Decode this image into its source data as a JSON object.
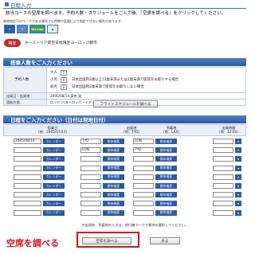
{
  "page": {
    "title": "日程入力",
    "intro": "該当コースの空席を調べます。予約人数・スケジュールをご入力後、『空席を調べる』をクリックしてください。",
    "note": "座席指定可のマークがある場合でも時期や区間により指定できない場合があります"
  },
  "icons": [
    {
      "name": "seat-icon",
      "label": "✈"
    },
    {
      "name": "info-icon",
      "label": "i"
    },
    {
      "name": "online-icon",
      "label": "On Line"
    },
    {
      "name": "ticket-icon",
      "label": "◆"
    }
  ],
  "plan": {
    "badge": "格安",
    "name": "オーストリア航空日程限定ヨーロッパ都市"
  },
  "section_pax": "搭乗人数をご入力ください",
  "pax": {
    "label": "予約人数",
    "rows": [
      {
        "cat": "大人",
        "value": "1",
        "desc": ""
      },
      {
        "cat": "小児",
        "value": "0",
        "desc": "日本出国時2歳以上12歳未満または2歳未満で座席をお取りする場合"
      },
      {
        "cat": "幼児",
        "value": "0",
        "desc": "日本出国時2歳未満で座席をお取りしない場合"
      }
    ]
  },
  "info": [
    {
      "label": "出発日・出発地",
      "value": "2005/08/14 東京 発"
    },
    {
      "label": "渡航方面",
      "value": "ロンドン(ヨーロッパ・イギリス)"
    }
  ],
  "buttons": {
    "schedule": "フライトスケジュールを調べる",
    "search": "空席を調べる",
    "back": "戻る",
    "calendar": "カレンダー",
    "city": "都市検索"
  },
  "section_dates": "日程をご入力ください（日付は現地日付）",
  "grid": {
    "head_date": "搭乗日\n(例：2005/07/23)",
    "head_dep": "出発地\n(例：TYO)",
    "head_arr": "到着地\n(例：LAX)",
    "head_time": "出発時間\n(例：12:00)"
  },
  "rows": [
    {
      "date": "2005/08/14",
      "dep": "TYO",
      "arr": "LON"
    },
    {
      "date": "",
      "dep": "LON",
      "arr": "TYO"
    },
    {
      "date": "",
      "dep": "",
      "arr": ""
    },
    {
      "date": "",
      "dep": "",
      "arr": ""
    },
    {
      "date": "",
      "dep": "",
      "arr": ""
    },
    {
      "date": "",
      "dep": "",
      "arr": ""
    },
    {
      "date": "",
      "dep": "",
      "arr": ""
    },
    {
      "date": "",
      "dep": "",
      "arr": ""
    },
    {
      "date": "",
      "dep": "",
      "arr": ""
    }
  ],
  "footnote": "※出発地、到着地の入力は、飛行機マークで都市を選択してください。",
  "callout": "空席を調べる"
}
